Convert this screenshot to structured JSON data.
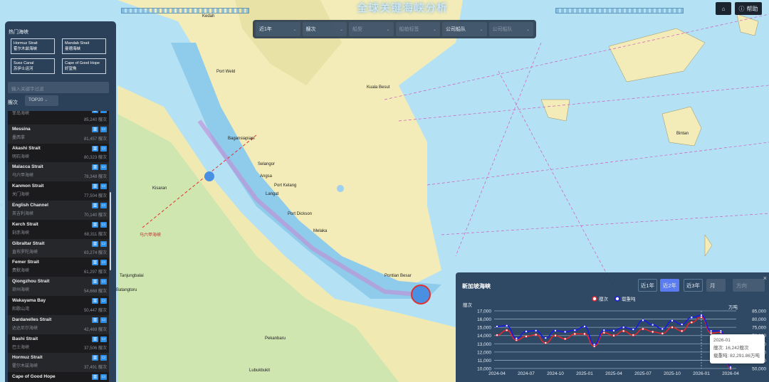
{
  "header": {
    "title": "全球关键海峡分析",
    "home_label": "",
    "help_label": "帮助"
  },
  "filters": [
    {
      "value": "近1年",
      "placeholder": false
    },
    {
      "value": "艘次",
      "placeholder": false
    },
    {
      "value": "船型",
      "placeholder": true
    },
    {
      "value": "船舶标签",
      "placeholder": true
    },
    {
      "value": "公司船队",
      "placeholder": false
    },
    {
      "value": "公司船队",
      "placeholder": true
    }
  ],
  "left_panel": {
    "title": "热门海峡",
    "hot": [
      {
        "en": "Hormuz Strait",
        "cn": "霍尔木兹海峡"
      },
      {
        "en": "Mandab Strait",
        "cn": "曼德海峡"
      },
      {
        "en": "Suez Canal",
        "cn": "苏伊士运河"
      },
      {
        "en": "Cape of Good Hope",
        "cn": "好望角"
      }
    ],
    "search_placeholder": "输入关键字过滤",
    "rank_label": "艘次",
    "rank_select": "TOP20",
    "collapse_icon": "‹",
    "items": [
      {
        "en": "",
        "cn": "菲岛海峡",
        "value": "85,240 艘次"
      },
      {
        "en": "Messina",
        "cn": "墨西拿",
        "value": "81,457 艘次"
      },
      {
        "en": "Akashi Strait",
        "cn": "明石海峡",
        "value": "80,323 艘次"
      },
      {
        "en": "Malacca Strait",
        "cn": "马六甲海峡",
        "value": "78,348 艘次"
      },
      {
        "en": "Kanmon Strait",
        "cn": "关门海峡",
        "value": "77,504 艘次"
      },
      {
        "en": "English Channel",
        "cn": "英吉利海峡",
        "value": "70,140 艘次"
      },
      {
        "en": "Kerch Strait",
        "cn": "刻赤海峡",
        "value": "68,311 艘次"
      },
      {
        "en": "Gibraltar Strait",
        "cn": "直布罗陀海峡",
        "value": "63,274 艘次"
      },
      {
        "en": "Femer Strait",
        "cn": "费默海峡",
        "value": "61,297 艘次"
      },
      {
        "en": "Qiongzhou Strait",
        "cn": "琼州海峡",
        "value": "54,668 艘次"
      },
      {
        "en": "Wakayama Bay",
        "cn": "和歌山湾",
        "value": "50,447 艘次"
      },
      {
        "en": "Dardanelles Strait",
        "cn": "达达尼尔海峡",
        "value": "42,469 艘次"
      },
      {
        "en": "Bashi Strait",
        "cn": "巴士海峡",
        "value": "37,506 艘次"
      },
      {
        "en": "Hormuz Strait",
        "cn": "霍尔木兹海峡",
        "value": "37,491 艘次"
      },
      {
        "en": "Cape of Good Hope",
        "cn": "好望角",
        "value": ""
      }
    ]
  },
  "map": {
    "places": [
      "Kedah",
      "Port Weld",
      "Kuala Besut",
      "Selangor",
      "Port Kelang",
      "Angsa",
      "Langat",
      "Port Dickson",
      "Melaka",
      "Bagansiapiapi",
      "Pontian Besar",
      "Tanjungbalai",
      "Pekanbaru",
      "Lubukbukit",
      "Bintan",
      "Batangtoru",
      "Kisaran",
      "马六甲海峡"
    ]
  },
  "chart": {
    "title": "新加坡海峡",
    "range_buttons": [
      "近1年",
      "近2年",
      "近3年"
    ],
    "active_range": "近2年",
    "granularity": "月",
    "direction_placeholder": "方向",
    "close_icon": "×",
    "tooltip": {
      "date": "2026-01",
      "line1": "艘次: 16,242艘次",
      "line2": "载重吨: 82,291.86万吨"
    }
  },
  "chart_data": {
    "type": "line",
    "title": "新加坡海峡",
    "x": [
      "2024-04",
      "2024-05",
      "2024-06",
      "2024-07",
      "2024-08",
      "2024-09",
      "2024-10",
      "2024-11",
      "2024-12",
      "2025-01",
      "2025-02",
      "2025-03",
      "2025-04",
      "2025-05",
      "2025-06",
      "2025-07",
      "2025-08",
      "2025-09",
      "2025-10",
      "2025-11",
      "2025-12",
      "2026-01",
      "2026-02",
      "2026-03",
      "2026-04"
    ],
    "xticks": [
      "2024-04",
      "2024-07",
      "2024-10",
      "2025-01",
      "2025-04",
      "2025-07",
      "2025-10",
      "2026-01",
      "2026-04"
    ],
    "ylabel_left": "艘次",
    "ylabel_right": "万吨",
    "ylim_left": [
      10000,
      17000
    ],
    "ylim_right": [
      50000,
      85000
    ],
    "yticks_left": [
      "10,000",
      "11,000",
      "12,000",
      "13,000",
      "14,000",
      "15,000",
      "16,000",
      "17,000"
    ],
    "yticks_right": [
      "50,000",
      "55,000",
      "60,000",
      "65,000",
      "70,000",
      "75,000",
      "80,000",
      "85,000"
    ],
    "legend_position": "top",
    "series": [
      {
        "name": "艘次",
        "axis": "left",
        "color": "#e0262e",
        "values": [
          14050,
          14650,
          13450,
          13900,
          14100,
          13100,
          14000,
          13600,
          14200,
          14200,
          12700,
          14350,
          14000,
          14550,
          14050,
          14800,
          14450,
          14250,
          15000,
          14550,
          15600,
          16242,
          14300,
          14400,
          10000
        ]
      },
      {
        "name": "载重吨",
        "axis": "right",
        "color": "#1a1ae0",
        "values": [
          75500,
          76000,
          68250,
          72500,
          73000,
          68500,
          73000,
          72250,
          73250,
          75500,
          64500,
          73250,
          73000,
          75000,
          73750,
          79250,
          76500,
          74000,
          79000,
          76750,
          81000,
          82292,
          72750,
          72750,
          50750
        ]
      }
    ]
  }
}
